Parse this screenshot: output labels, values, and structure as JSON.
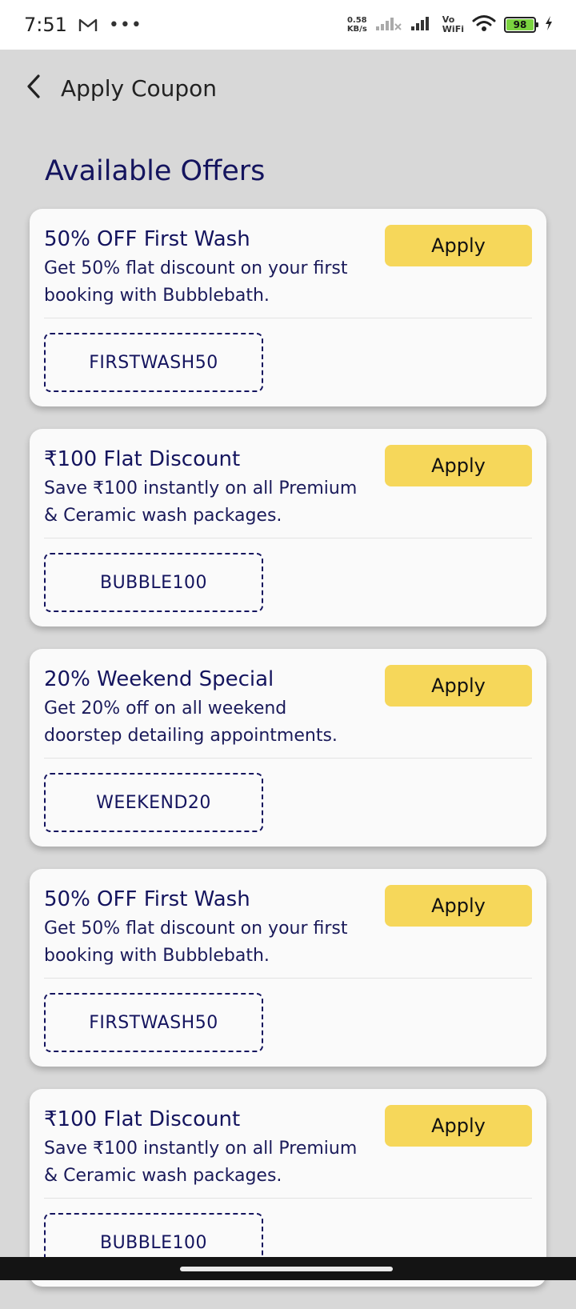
{
  "status_bar": {
    "time": "7:51",
    "speed_value": "0.58",
    "speed_unit": "KB/s",
    "vo_top": "Vo",
    "vo_bottom": "WiFi",
    "battery_level": "98",
    "icons": [
      "gmail-icon",
      "more-dots-icon",
      "signal-icon",
      "wifi-icon",
      "battery-icon",
      "charging-icon"
    ]
  },
  "header": {
    "title": "Apply Coupon",
    "back_icon": "chevron-left-icon"
  },
  "section_title": "Available Offers",
  "offers": [
    {
      "title": "50% OFF First Wash",
      "description": "Get 50% flat discount on your first booking with Bubblebath.",
      "code": "FIRSTWASH50",
      "apply_label": "Apply"
    },
    {
      "title": "₹100 Flat Discount",
      "description": "Save ₹100 instantly on all Premium & Ceramic wash packages.",
      "code": "BUBBLE100",
      "apply_label": "Apply"
    },
    {
      "title": "20% Weekend Special",
      "description": "Get 20% off on all weekend doorstep detailing appointments.",
      "code": "WEEKEND20",
      "apply_label": "Apply"
    },
    {
      "title": "50% OFF First Wash",
      "description": "Get 50% flat discount on your first booking with Bubblebath.",
      "code": "FIRSTWASH50",
      "apply_label": "Apply"
    },
    {
      "title": "₹100 Flat Discount",
      "description": "Save ₹100 instantly on all Premium & Ceramic wash packages.",
      "code": "BUBBLE100",
      "apply_label": "Apply"
    }
  ],
  "colors": {
    "background": "#d8d8d8",
    "card": "#fafafa",
    "accent_text": "#14145e",
    "apply_button": "#f6d75a",
    "nav_bar": "#141414"
  }
}
